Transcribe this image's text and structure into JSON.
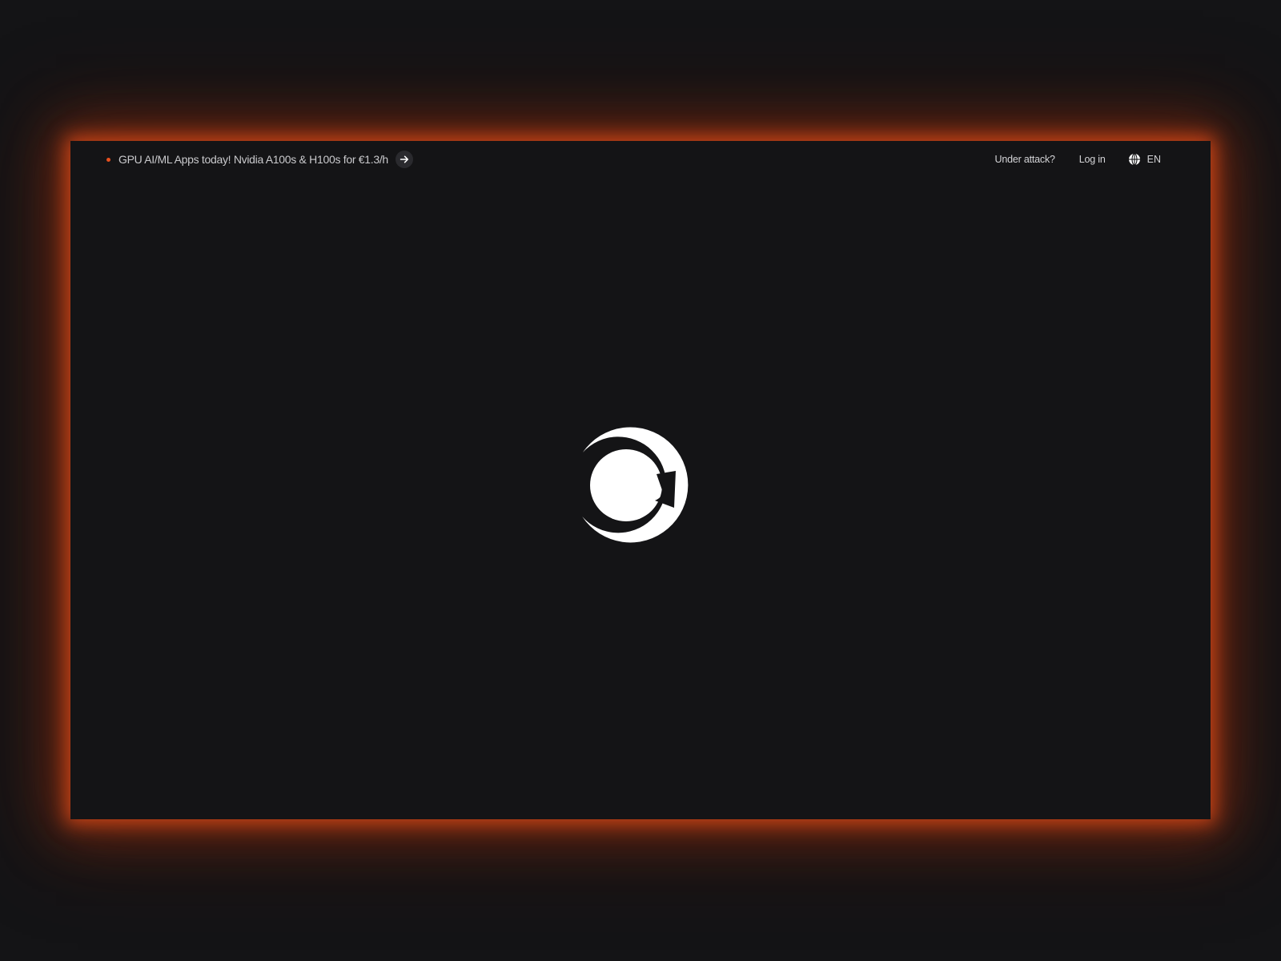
{
  "announcement": {
    "text": "GPU AI/ML Apps today! Nvidia A100s & H100s for €1.3/h",
    "icon": "arrow-right-icon"
  },
  "nav": {
    "under_attack": "Under attack?",
    "login": "Log in",
    "language": "EN",
    "language_icon": "globe-icon"
  },
  "loader": {
    "icon": "brand-logo-icon"
  },
  "colors": {
    "background": "#141416",
    "accent": "#e8501f",
    "glow": "#b8401a",
    "text": "#d4d4d7"
  }
}
